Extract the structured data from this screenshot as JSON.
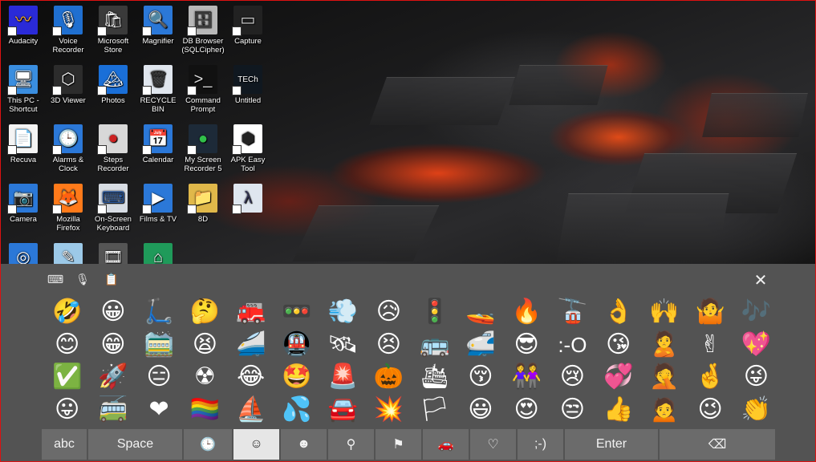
{
  "desktop": {
    "icons": [
      {
        "label": "Audacity",
        "icon": "audacity-icon",
        "glyph": "〰",
        "bg": "#2a2ad8",
        "fg": "#ffb020"
      },
      {
        "label": "Voice\nRecorder",
        "icon": "microphone-icon",
        "glyph": "🎙",
        "bg": "#1f6fd0",
        "fg": "#fff"
      },
      {
        "label": "Microsoft\nStore",
        "icon": "store-bag-icon",
        "glyph": "🛍",
        "bg": "#3a3a3a",
        "fg": "#fff"
      },
      {
        "label": "Magnifier",
        "icon": "magnifier-icon",
        "glyph": "🔍",
        "bg": "#2b78d8",
        "fg": "#fff"
      },
      {
        "label": "DB Browser\n(SQLCipher)",
        "icon": "database-icon",
        "glyph": "🗄",
        "bg": "#b8b8b8",
        "fg": "#333"
      },
      {
        "label": "Capture",
        "icon": "capture-window-icon",
        "glyph": "▭",
        "bg": "#222",
        "fg": "#ddd"
      },
      {
        "label": "This PC -\nShortcut",
        "icon": "computer-icon",
        "glyph": "🖥",
        "bg": "#3a8ee0",
        "fg": "#fff"
      },
      {
        "label": "3D Viewer",
        "icon": "cube-icon",
        "glyph": "⬡",
        "bg": "#2c2c2c",
        "fg": "#fff"
      },
      {
        "label": "Photos",
        "icon": "photos-icon",
        "glyph": "🏔",
        "bg": "#1a6fd8",
        "fg": "#fff"
      },
      {
        "label": "RECYCLE\nBIN",
        "icon": "recycle-bin-icon",
        "glyph": "🗑",
        "bg": "#e0e6ee",
        "fg": "#333"
      },
      {
        "label": "Command\nPrompt",
        "icon": "terminal-icon",
        "glyph": ">_",
        "bg": "#111",
        "fg": "#ddd"
      },
      {
        "label": "Untitled",
        "icon": "tech-logo-icon",
        "glyph": "TECh",
        "bg": "#101820",
        "fg": "#fff"
      },
      {
        "label": "Recuva",
        "icon": "document-icon",
        "glyph": "📄",
        "bg": "#f4f4f4",
        "fg": "#333"
      },
      {
        "label": "Alarms &\nClock",
        "icon": "clock-icon",
        "glyph": "🕒",
        "bg": "#2b78d8",
        "fg": "#fff"
      },
      {
        "label": "Steps\nRecorder",
        "icon": "steps-recorder-icon",
        "glyph": "⏺",
        "bg": "#d8d8d8",
        "fg": "#c22"
      },
      {
        "label": "Calendar",
        "icon": "calendar-icon",
        "glyph": "📅",
        "bg": "#2b78d8",
        "fg": "#fff"
      },
      {
        "label": "My Screen\nRecorder 5",
        "icon": "screen-recorder-icon",
        "glyph": "●",
        "bg": "#1d2a38",
        "fg": "#31c04a"
      },
      {
        "label": "APK Easy\nTool",
        "icon": "apk-tool-icon",
        "glyph": "⬢",
        "bg": "#ffffff",
        "fg": "#222"
      },
      {
        "label": "Camera",
        "icon": "camera-icon",
        "glyph": "📷",
        "bg": "#2b78d8",
        "fg": "#fff"
      },
      {
        "label": "Mozilla\nFirefox",
        "icon": "firefox-icon",
        "glyph": "🦊",
        "bg": "#ff7a1a",
        "fg": "#fff"
      },
      {
        "label": "On-Screen\nKeyboard",
        "icon": "keyboard-icon",
        "glyph": "⌨",
        "bg": "#d8dde4",
        "fg": "#2b5aa0"
      },
      {
        "label": "Films & TV",
        "icon": "films-tv-icon",
        "glyph": "▶",
        "bg": "#2b78d8",
        "fg": "#fff"
      },
      {
        "label": "8D",
        "icon": "folder-icon",
        "glyph": "📁",
        "bg": "#e0b84a",
        "fg": "#fff"
      },
      {
        "label": "",
        "icon": "app-icon-lambda",
        "glyph": "λ",
        "bg": "#dfe6ef",
        "fg": "#335"
      },
      {
        "label": "",
        "icon": "disc-icon",
        "glyph": "◎",
        "bg": "#2b78d8",
        "fg": "#fff"
      },
      {
        "label": "",
        "icon": "notepad-icon",
        "glyph": "✎",
        "bg": "#9cc9e8",
        "fg": "#fff"
      },
      {
        "label": "",
        "icon": "film-strip-icon",
        "glyph": "🎞",
        "bg": "#555",
        "fg": "#fff"
      },
      {
        "label": "",
        "icon": "green-house-icon",
        "glyph": "⌂",
        "bg": "#1f9a5a",
        "fg": "#fff"
      }
    ]
  },
  "keyboard": {
    "toolbar": {
      "keyboard_glyph": "⌨",
      "mic_glyph": "🎙",
      "clipboard_glyph": "📋",
      "close_glyph": "✕"
    },
    "emoji_rows": [
      [
        "🤣",
        "😀",
        "🛴",
        "🤔",
        "🚒",
        "🚥",
        "💨",
        "😥",
        "🚦",
        "🚤",
        "🔥",
        "🚡",
        "👌",
        "🙌",
        "🤷",
        "🎶"
      ],
      [
        "😊",
        "😁",
        "🚞",
        "😫",
        "🚄",
        "🚇",
        "🛰",
        "😣",
        "🚌",
        "🚅",
        "😎",
        ":-O",
        "😘",
        "🙎",
        "✌",
        "💖"
      ],
      [
        "✅",
        "🚀",
        "😑",
        "☢",
        "😂",
        "🤩",
        "🚨",
        "🎃",
        "🛳",
        "😚",
        "👭",
        "😢",
        "💞",
        "🤦",
        "🤞",
        "😜"
      ],
      [
        "😛",
        "🚎",
        "❤",
        "🏳‍🌈",
        "⛵",
        "💦",
        "🚘",
        "💥",
        "🏳",
        "😃",
        "😍",
        "😒",
        "👍",
        "🙍",
        "😉",
        "👏"
      ]
    ],
    "bottom_keys": [
      {
        "name": "abc-key",
        "label": "abc",
        "width": 56
      },
      {
        "name": "space-key",
        "label": "Space",
        "width": 117
      },
      {
        "name": "recent-tab",
        "label": "🕒",
        "width": 60
      },
      {
        "name": "smileys-tab",
        "label": "☺",
        "width": 57,
        "active": true
      },
      {
        "name": "people-tab",
        "label": "☻",
        "width": 57
      },
      {
        "name": "places-tab",
        "label": "⚲",
        "width": 57
      },
      {
        "name": "celebration-tab",
        "label": "⚑",
        "width": 57
      },
      {
        "name": "vehicles-tab",
        "label": "🚗",
        "width": 57
      },
      {
        "name": "hearts-tab",
        "label": "♡",
        "width": 57
      },
      {
        "name": "text-emoticons-tab",
        "label": ";-)",
        "width": 57
      },
      {
        "name": "enter-key",
        "label": "Enter",
        "width": 116
      },
      {
        "name": "backspace-key",
        "label": "⌫",
        "width": 144
      }
    ]
  }
}
